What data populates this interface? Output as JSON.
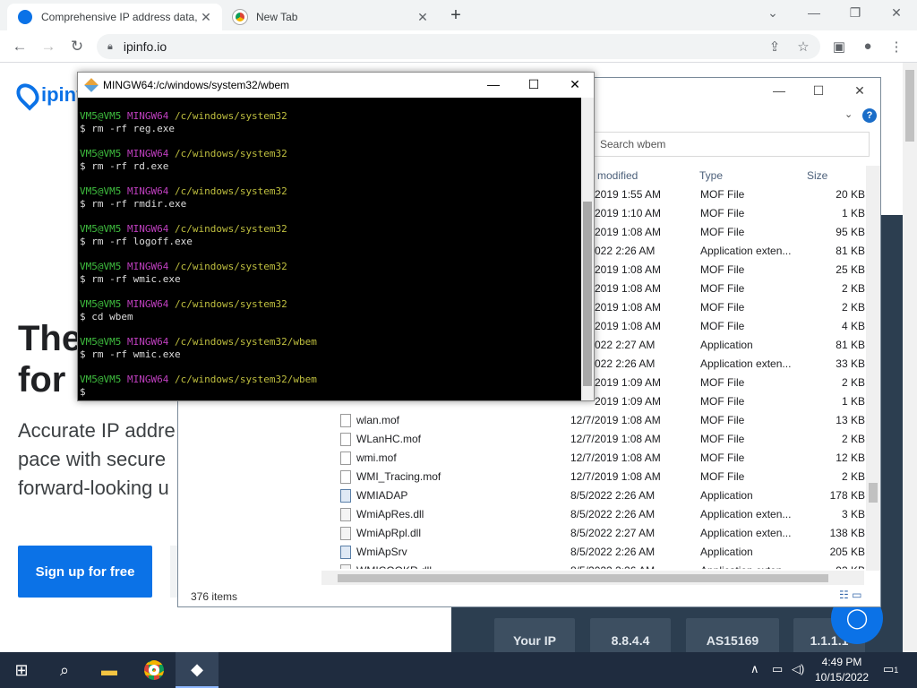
{
  "browser": {
    "tabs": [
      {
        "title": "Comprehensive IP address data,",
        "active": true
      },
      {
        "title": "New Tab",
        "active": false
      }
    ],
    "url": "ipinfo.io"
  },
  "site": {
    "logo_text": "ipinf",
    "hero_title": "The\nfor",
    "hero_sub": "Accurate IP addre pace with secure forward-looking u",
    "signup": "Sign up for free",
    "ip_pills": [
      "Your IP",
      "8.8.4.4",
      "AS15169",
      "1.1.1.1"
    ]
  },
  "explorer": {
    "search_placeholder": "Search wbem",
    "columns": [
      "modified",
      "Type",
      "Size"
    ],
    "rows": [
      {
        "name": "",
        "date": "2019 1:55 AM",
        "type": "MOF File",
        "size": "20 KB",
        "icon": "mof"
      },
      {
        "name": "",
        "date": "2019 1:10 AM",
        "type": "MOF File",
        "size": "1 KB",
        "icon": "mof"
      },
      {
        "name": "",
        "date": "2019 1:08 AM",
        "type": "MOF File",
        "size": "95 KB",
        "icon": "mof"
      },
      {
        "name": "",
        "date": "022 2:26 AM",
        "type": "Application exten...",
        "size": "81 KB",
        "icon": "dll"
      },
      {
        "name": "",
        "date": "2019 1:08 AM",
        "type": "MOF File",
        "size": "25 KB",
        "icon": "mof"
      },
      {
        "name": "",
        "date": "2019 1:08 AM",
        "type": "MOF File",
        "size": "2 KB",
        "icon": "mof"
      },
      {
        "name": "",
        "date": "2019 1:08 AM",
        "type": "MOF File",
        "size": "2 KB",
        "icon": "mof"
      },
      {
        "name": "",
        "date": "2019 1:08 AM",
        "type": "MOF File",
        "size": "4 KB",
        "icon": "mof"
      },
      {
        "name": "",
        "date": "022 2:27 AM",
        "type": "Application",
        "size": "81 KB",
        "icon": "app"
      },
      {
        "name": "",
        "date": "022 2:26 AM",
        "type": "Application exten...",
        "size": "33 KB",
        "icon": "dll"
      },
      {
        "name": "",
        "date": "2019 1:09 AM",
        "type": "MOF File",
        "size": "2 KB",
        "icon": "mof"
      },
      {
        "name": "",
        "date": "2019 1:09 AM",
        "type": "MOF File",
        "size": "1 KB",
        "icon": "mof"
      },
      {
        "name": "wlan.mof",
        "date": "12/7/2019 1:08 AM",
        "type": "MOF File",
        "size": "13 KB",
        "icon": "mof"
      },
      {
        "name": "WLanHC.mof",
        "date": "12/7/2019 1:08 AM",
        "type": "MOF File",
        "size": "2 KB",
        "icon": "mof"
      },
      {
        "name": "wmi.mof",
        "date": "12/7/2019 1:08 AM",
        "type": "MOF File",
        "size": "12 KB",
        "icon": "mof"
      },
      {
        "name": "WMI_Tracing.mof",
        "date": "12/7/2019 1:08 AM",
        "type": "MOF File",
        "size": "2 KB",
        "icon": "mof"
      },
      {
        "name": "WMIADAP",
        "date": "8/5/2022 2:26 AM",
        "type": "Application",
        "size": "178 KB",
        "icon": "app"
      },
      {
        "name": "WmiApRes.dll",
        "date": "8/5/2022 2:26 AM",
        "type": "Application exten...",
        "size": "3 KB",
        "icon": "dll"
      },
      {
        "name": "WmiApRpl.dll",
        "date": "8/5/2022 2:27 AM",
        "type": "Application exten...",
        "size": "138 KB",
        "icon": "dll"
      },
      {
        "name": "WmiApSrv",
        "date": "8/5/2022 2:26 AM",
        "type": "Application",
        "size": "205 KB",
        "icon": "app"
      },
      {
        "name": "WMICOOKR.dll",
        "date": "8/5/2022 2:26 AM",
        "type": "Application exten...",
        "size": "93 KB",
        "icon": "dll"
      }
    ],
    "item_count": "376 items"
  },
  "terminal": {
    "title": "MINGW64:/c/windows/system32/wbem",
    "lines": [
      {
        "user": "VM5@VM5",
        "env": "MINGW64",
        "path": "/c/windows/system32",
        "cmd": "$ rm -rf reg.exe"
      },
      {
        "user": "VM5@VM5",
        "env": "MINGW64",
        "path": "/c/windows/system32",
        "cmd": "$ rm -rf rd.exe"
      },
      {
        "user": "VM5@VM5",
        "env": "MINGW64",
        "path": "/c/windows/system32",
        "cmd": "$ rm -rf rmdir.exe"
      },
      {
        "user": "VM5@VM5",
        "env": "MINGW64",
        "path": "/c/windows/system32",
        "cmd": "$ rm -rf logoff.exe"
      },
      {
        "user": "VM5@VM5",
        "env": "MINGW64",
        "path": "/c/windows/system32",
        "cmd": "$ rm -rf wmic.exe"
      },
      {
        "user": "VM5@VM5",
        "env": "MINGW64",
        "path": "/c/windows/system32",
        "cmd": "$ cd wbem"
      },
      {
        "user": "VM5@VM5",
        "env": "MINGW64",
        "path": "/c/windows/system32/wbem",
        "cmd": "$ rm -rf wmic.exe"
      },
      {
        "user": "VM5@VM5",
        "env": "MINGW64",
        "path": "/c/windows/system32/wbem",
        "cmd": "$"
      }
    ]
  },
  "taskbar": {
    "time": "4:49 PM",
    "date": "10/15/2022",
    "notif_count": "1"
  },
  "colors": {
    "accent": "#0b72e7",
    "terminal_user": "#3fbf3f",
    "terminal_env": "#bf3fbf",
    "terminal_path": "#bfbf3f"
  }
}
